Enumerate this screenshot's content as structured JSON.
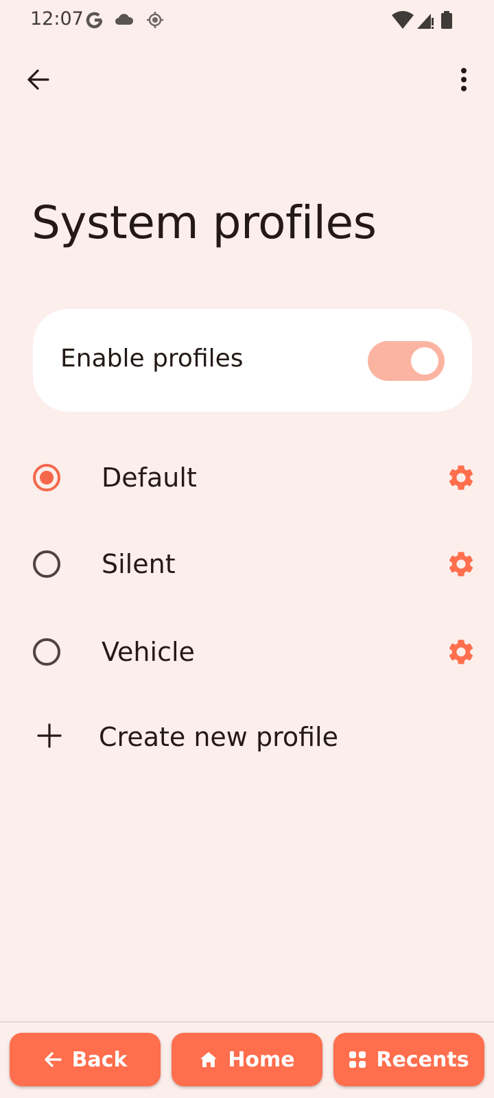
{
  "status_bar": {
    "time": "12:07",
    "left_icons": [
      "google-icon",
      "cloud-icon",
      "location-icon"
    ],
    "right_icons": [
      "wifi-icon",
      "cellular-icon",
      "battery-icon"
    ]
  },
  "toolbar": {
    "back_icon": "arrow-left-icon",
    "more_icon": "more-vert-icon"
  },
  "page": {
    "title": "System profiles"
  },
  "enable_profiles": {
    "label": "Enable profiles",
    "enabled": true
  },
  "profiles": [
    {
      "label": "Default",
      "selected": true,
      "settings_icon": "gear-icon"
    },
    {
      "label": "Silent",
      "selected": false,
      "settings_icon": "gear-icon"
    },
    {
      "label": "Vehicle",
      "selected": false,
      "settings_icon": "gear-icon"
    }
  ],
  "create_profile": {
    "label": "Create new profile",
    "icon": "plus-icon"
  },
  "nav": {
    "back_label": "Back",
    "home_label": "Home",
    "recents_label": "Recents"
  },
  "colors": {
    "accent": "#FF6E4D",
    "radio_selected": "#F4674A",
    "switch_track": "#FCB4A2",
    "background": "#FBEEEB"
  }
}
